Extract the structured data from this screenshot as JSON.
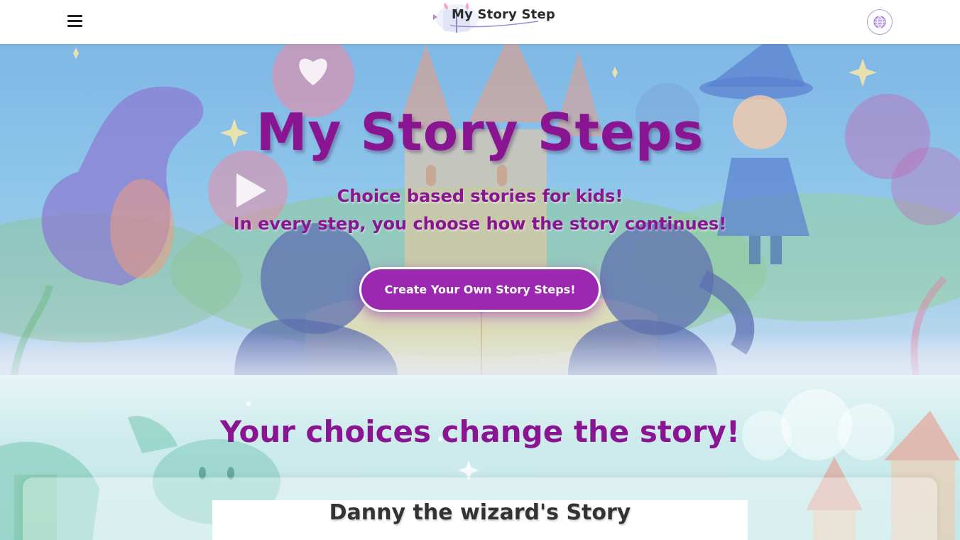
{
  "header": {
    "menu_icon": "hamburger-menu-icon",
    "logo_text": "My Story Step",
    "language_icon": "globe-icon"
  },
  "hero": {
    "title": "My Story Steps",
    "subtitle_line1": "Choice based stories for kids!",
    "subtitle_line2": "In every step, you choose how the story continues!",
    "cta_label": "Create Your Own Story Steps!",
    "accent_color": "#9c27b0",
    "title_color": "#8a1592"
  },
  "section2": {
    "title": "Your choices change the story!",
    "story_title": "Danny the wizard's Story"
  }
}
